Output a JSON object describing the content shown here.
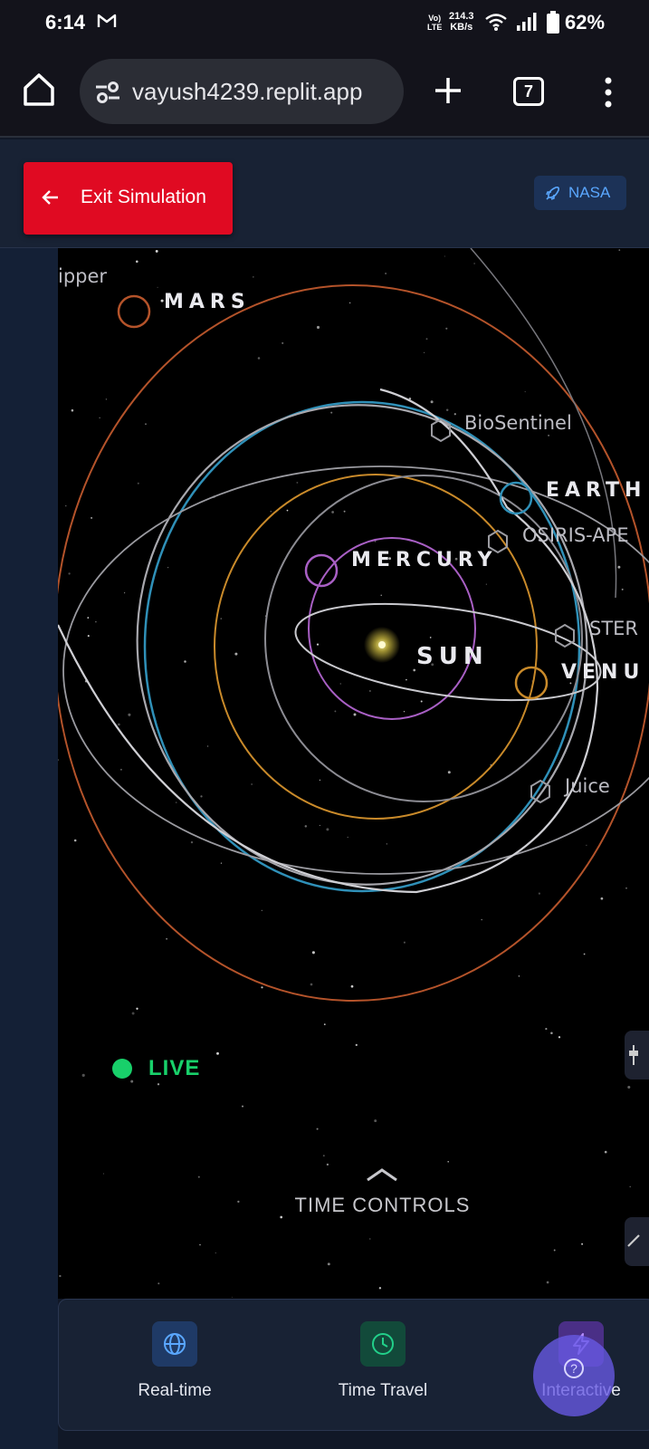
{
  "status_bar": {
    "time": "6:14",
    "network_top": "Vo)",
    "network_bottom": "LTE",
    "speed_value": "214.3",
    "speed_unit": "KB/s",
    "battery": "62%",
    "icons": [
      "gmail-icon",
      "wifi-icon",
      "signal-icon",
      "battery-icon"
    ]
  },
  "browser": {
    "url": "vayush4239.replit.app",
    "tab_count": "7",
    "icons": [
      "home-icon",
      "site-settings-icon",
      "plus-icon",
      "more-vert-icon"
    ]
  },
  "header": {
    "exit_label": "Exit Simulation",
    "exit_color": "#e00a22",
    "nasa_label": "NASA"
  },
  "simulation": {
    "sun_label": "SUN",
    "planets": {
      "mercury": "MERCURY",
      "venus": "VENU",
      "earth": "EARTH",
      "mars": "MARS"
    },
    "spacecraft": {
      "clipper": "ipper",
      "biosentinel": "BioSentinel",
      "osiris": "OSIRIS-APE",
      "stereo": "STER",
      "juice": "Juice"
    },
    "planet_colors": {
      "mercury": "#a85fc4",
      "venus": "#c98a2a",
      "earth": "#2f90b8",
      "mars": "#b4532a"
    },
    "live_label": "LIVE",
    "live_color": "#18d06a",
    "time_controls_label": "TIME CONTROLS"
  },
  "bottom_nav": {
    "items": [
      {
        "label": "Real-time",
        "icon": "globe-icon"
      },
      {
        "label": "Time Travel",
        "icon": "clock-icon"
      },
      {
        "label": "Interactive",
        "icon": "lightning-icon"
      }
    ],
    "help_icon": "help-icon"
  }
}
